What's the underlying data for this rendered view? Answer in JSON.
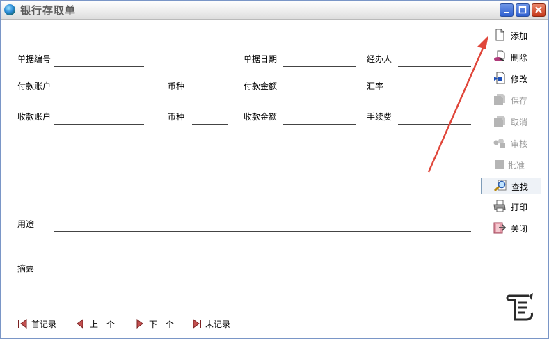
{
  "window": {
    "title": "银行存取单"
  },
  "form": {
    "row1": {
      "doc_no": "单据编号",
      "doc_date": "单据日期",
      "handler": "经办人"
    },
    "row2": {
      "pay_account": "付款账户",
      "currency": "币种",
      "pay_amount": "付款金额",
      "rate": "汇率"
    },
    "row3": {
      "recv_account": "收款账户",
      "currency": "币种",
      "recv_amount": "收款金额",
      "fee": "手续费"
    },
    "purpose": "用途",
    "summary": "摘要"
  },
  "sidebar": {
    "add": "添加",
    "delete": "删除",
    "edit": "修改",
    "save": "保存",
    "cancel": "取消",
    "audit": "审核",
    "approve": "批准",
    "find": "查找",
    "print": "打印",
    "close": "关闭"
  },
  "nav": {
    "first": "首记录",
    "prev": "上一个",
    "next": "下一个",
    "last": "末记录"
  },
  "colors": {
    "annotation_arrow": "#e0463a",
    "title_text": "#5a5a5a",
    "disabled_text": "#9a9a9a"
  }
}
